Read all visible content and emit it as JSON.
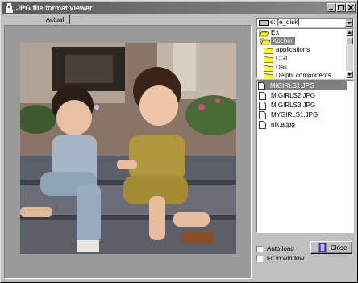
{
  "window": {
    "title": "JPG file format viewer"
  },
  "tabs": [
    {
      "label": "Actual"
    }
  ],
  "drive": {
    "selected": "e: [e_disk]"
  },
  "directories": {
    "items": [
      {
        "label": "E:\\",
        "icon": "open-folder-icon",
        "selected": false
      },
      {
        "label": "Kochini",
        "icon": "open-folder-icon",
        "selected": true
      },
      {
        "label": "applications",
        "icon": "folder-icon",
        "selected": false
      },
      {
        "label": "CGI",
        "icon": "folder-icon",
        "selected": false
      },
      {
        "label": "Dali",
        "icon": "folder-icon",
        "selected": false
      },
      {
        "label": "Delphi components",
        "icon": "folder-icon",
        "selected": false
      }
    ]
  },
  "files": {
    "items": [
      {
        "label": "MIGIRLS1.JPG",
        "selected": true
      },
      {
        "label": "MIGIRLS2.JPG",
        "selected": false
      },
      {
        "label": "MIGIRLS3.JPG",
        "selected": false
      },
      {
        "label": "MYGIRLS1.JPG",
        "selected": false
      },
      {
        "label": "nik.a.jpg",
        "selected": false
      }
    ]
  },
  "options": {
    "auto_load": {
      "label": "Auto load",
      "checked": false
    },
    "fit_in_window": {
      "label": "Fit in window",
      "checked": false
    }
  },
  "buttons": {
    "close_label": "Close"
  },
  "colors": {
    "titlebar_start": "#5a5a5a",
    "titlebar_end": "#8a8a8a",
    "selection": "#808080",
    "face": "#c0c0c0"
  }
}
